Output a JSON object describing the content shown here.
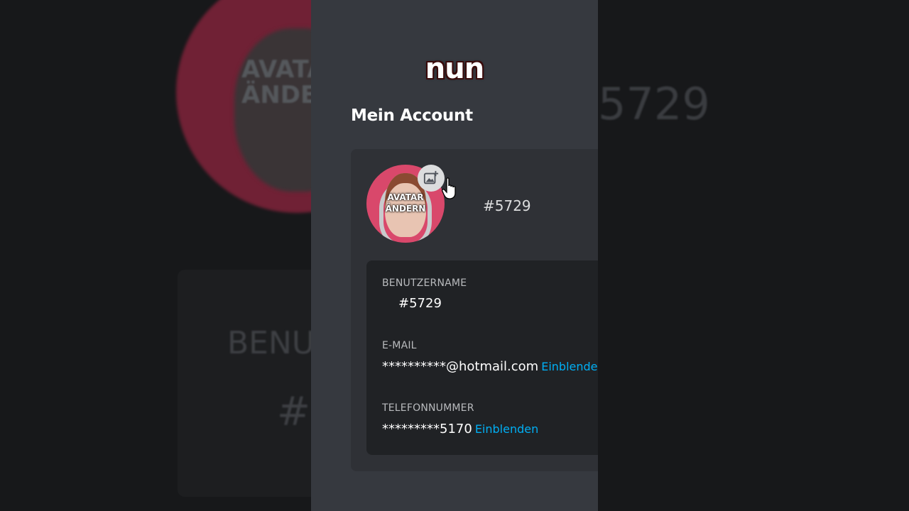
{
  "caption": "nun",
  "page_title": "Mein Account",
  "profile": {
    "avatar_overlay_line1": "AVATAR",
    "avatar_overlay_line2": "ÄNDERN",
    "discriminator": "#5729"
  },
  "fields": {
    "username": {
      "label": "BENUTZERNAME",
      "value": "#5729"
    },
    "email": {
      "label": "E-MAIL",
      "value": "**********@hotmail.com",
      "reveal": "Einblenden"
    },
    "phone": {
      "label": "TELEFONNUMMER",
      "value": "*********5170",
      "reveal": "Einblenden"
    }
  },
  "background": {
    "left_avatar_text": "AVATAR ÄNDERN",
    "left_label": "BENU",
    "left_discrim": "#5",
    "right_discrim": "5729"
  },
  "colors": {
    "panel": "#36393f",
    "card": "#2f3136",
    "info_box": "#202225",
    "avatar_bg": "#d9486b",
    "link": "#00aff4"
  },
  "icons": [
    "add-image-icon",
    "hand-cursor-icon"
  ]
}
